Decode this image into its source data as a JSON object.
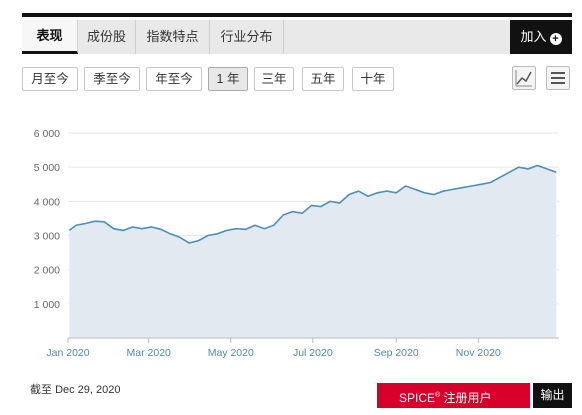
{
  "tabs": [
    {
      "label": "表现",
      "active": true
    },
    {
      "label": "成份股",
      "active": false
    },
    {
      "label": "指数特点",
      "active": false
    },
    {
      "label": "行业分布",
      "active": false
    }
  ],
  "add_button": {
    "label": "加入",
    "icon": "plus-circle-icon"
  },
  "ranges": [
    {
      "label": "月至今",
      "active": false
    },
    {
      "label": "季至今",
      "active": false
    },
    {
      "label": "年至今",
      "active": false
    },
    {
      "label": "1 年",
      "active": true
    },
    {
      "label": "三年",
      "active": false
    },
    {
      "label": "五年",
      "active": false
    },
    {
      "label": "十年",
      "active": false
    }
  ],
  "chart_tools": [
    "line-chart-icon",
    "menu-icon"
  ],
  "chart_data": {
    "type": "area",
    "title": "",
    "xlabel": "",
    "ylabel": "",
    "ylim": [
      0,
      6000
    ],
    "yticks": [
      {
        "v": 1000,
        "label": "1 000"
      },
      {
        "v": 2000,
        "label": "2 000"
      },
      {
        "v": 3000,
        "label": "3 000"
      },
      {
        "v": 4000,
        "label": "4 000"
      },
      {
        "v": 5000,
        "label": "5 000"
      },
      {
        "v": 6000,
        "label": "6 000"
      }
    ],
    "xticks": [
      "Jan 2020",
      "Mar 2020",
      "May 2020",
      "Jul 2020",
      "Sep 2020",
      "Nov 2020"
    ],
    "grid": true,
    "line_color": "#4a90b8",
    "fill_color": "#e3e9f1",
    "series": [
      {
        "x": [
          "2020-01-02",
          "2020-01-07",
          "2020-01-14",
          "2020-01-21",
          "2020-01-28",
          "2020-02-04",
          "2020-02-11",
          "2020-02-18",
          "2020-02-25",
          "2020-03-03",
          "2020-03-10",
          "2020-03-17",
          "2020-03-24",
          "2020-03-31",
          "2020-04-07",
          "2020-04-14",
          "2020-04-21",
          "2020-04-28",
          "2020-05-05",
          "2020-05-12",
          "2020-05-19",
          "2020-05-26",
          "2020-06-02",
          "2020-06-09",
          "2020-06-16",
          "2020-06-23",
          "2020-06-30",
          "2020-07-07",
          "2020-07-14",
          "2020-07-21",
          "2020-07-28",
          "2020-08-04",
          "2020-08-11",
          "2020-08-18",
          "2020-08-25",
          "2020-09-01",
          "2020-09-08",
          "2020-09-15",
          "2020-09-22",
          "2020-09-29",
          "2020-10-06",
          "2020-10-13",
          "2020-10-20",
          "2020-10-27",
          "2020-11-03",
          "2020-11-10",
          "2020-11-17",
          "2020-11-24",
          "2020-12-01",
          "2020-12-08",
          "2020-12-15",
          "2020-12-22",
          "2020-12-29"
        ],
        "values": [
          3150,
          3300,
          3350,
          3420,
          3400,
          3200,
          3150,
          3250,
          3200,
          3250,
          3180,
          3050,
          2950,
          2780,
          2850,
          3000,
          3050,
          3150,
          3200,
          3180,
          3300,
          3200,
          3300,
          3600,
          3700,
          3650,
          3880,
          3850,
          4000,
          3950,
          4200,
          4300,
          4150,
          4250,
          4300,
          4250,
          4450,
          4350,
          4250,
          4200,
          4300,
          4350,
          4400,
          4450,
          4500,
          4550,
          4700,
          4850,
          5000,
          4950,
          5050,
          4950,
          4850
        ]
      }
    ]
  },
  "as_of": {
    "label": "截至",
    "date": "Dec 29, 2020"
  },
  "spice_button": {
    "brand": "SPICE",
    "mark": "®",
    "label": "注册用户"
  },
  "export_button": {
    "label": "输出"
  }
}
